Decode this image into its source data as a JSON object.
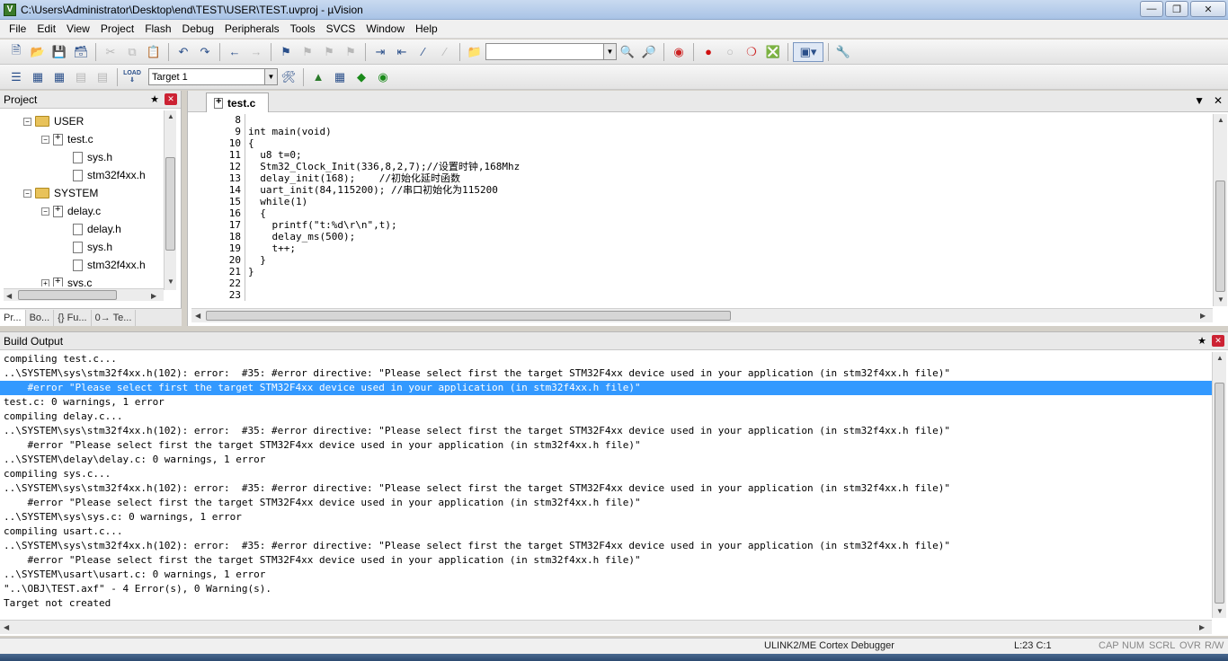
{
  "window": {
    "title": "C:\\Users\\Administrator\\Desktop\\end\\TEST\\USER\\TEST.uvproj - µVision",
    "app_icon": "V"
  },
  "menu": [
    "File",
    "Edit",
    "View",
    "Project",
    "Flash",
    "Debug",
    "Peripherals",
    "Tools",
    "SVCS",
    "Window",
    "Help"
  ],
  "toolbar2": {
    "target": "Target 1",
    "load_label": "LOAD"
  },
  "project": {
    "title": "Project",
    "tree": [
      {
        "label": "USER",
        "type": "folder",
        "level": 1
      },
      {
        "label": "test.c",
        "type": "cfile",
        "level": 2
      },
      {
        "label": "sys.h",
        "type": "hfile",
        "level": 3
      },
      {
        "label": "stm32f4xx.h",
        "type": "hfile",
        "level": 3
      },
      {
        "label": "SYSTEM",
        "type": "folder",
        "level": 1
      },
      {
        "label": "delay.c",
        "type": "cfile",
        "level": 2
      },
      {
        "label": "delay.h",
        "type": "hfile",
        "level": 3
      },
      {
        "label": "sys.h",
        "type": "hfile",
        "level": 3
      },
      {
        "label": "stm32f4xx.h",
        "type": "hfile",
        "level": 3
      },
      {
        "label": "sys.c",
        "type": "cfile",
        "level": 2
      }
    ],
    "tabs": [
      "Pr...",
      "Bo...",
      "{} Fu...",
      "0→ Te..."
    ]
  },
  "editor": {
    "tab": "test.c",
    "lines": [
      {
        "n": "8",
        "t": ""
      },
      {
        "n": "9",
        "t": "int main(void)"
      },
      {
        "n": "10",
        "t": "{"
      },
      {
        "n": "11",
        "t": "  u8 t=0;"
      },
      {
        "n": "12",
        "t": "  Stm32_Clock_Init(336,8,2,7);//设置时钟,168Mhz"
      },
      {
        "n": "13",
        "t": "  delay_init(168);    //初始化延时函数"
      },
      {
        "n": "14",
        "t": "  uart_init(84,115200); //串口初始化为115200"
      },
      {
        "n": "15",
        "t": "  while(1)"
      },
      {
        "n": "16",
        "t": "  {"
      },
      {
        "n": "17",
        "t": "    printf(\"t:%d\\r\\n\",t);"
      },
      {
        "n": "18",
        "t": "    delay_ms(500);"
      },
      {
        "n": "19",
        "t": "    t++;"
      },
      {
        "n": "20",
        "t": "  }"
      },
      {
        "n": "21",
        "t": "}"
      },
      {
        "n": "22",
        "t": ""
      },
      {
        "n": "23",
        "t": ""
      }
    ]
  },
  "build": {
    "title": "Build Output",
    "lines": [
      "compiling test.c...",
      "..\\SYSTEM\\sys\\stm32f4xx.h(102): error:  #35: #error directive: \"Please select first the target STM32F4xx device used in your application (in stm32f4xx.h file)\"",
      "    #error \"Please select first the target STM32F4xx device used in your application (in stm32f4xx.h file)\"",
      "test.c: 0 warnings, 1 error",
      "compiling delay.c...",
      "..\\SYSTEM\\sys\\stm32f4xx.h(102): error:  #35: #error directive: \"Please select first the target STM32F4xx device used in your application (in stm32f4xx.h file)\"",
      "    #error \"Please select first the target STM32F4xx device used in your application (in stm32f4xx.h file)\"",
      "..\\SYSTEM\\delay\\delay.c: 0 warnings, 1 error",
      "compiling sys.c...",
      "..\\SYSTEM\\sys\\stm32f4xx.h(102): error:  #35: #error directive: \"Please select first the target STM32F4xx device used in your application (in stm32f4xx.h file)\"",
      "    #error \"Please select first the target STM32F4xx device used in your application (in stm32f4xx.h file)\"",
      "..\\SYSTEM\\sys\\sys.c: 0 warnings, 1 error",
      "compiling usart.c...",
      "..\\SYSTEM\\sys\\stm32f4xx.h(102): error:  #35: #error directive: \"Please select first the target STM32F4xx device used in your application (in stm32f4xx.h file)\"",
      "    #error \"Please select first the target STM32F4xx device used in your application (in stm32f4xx.h file)\"",
      "..\\SYSTEM\\usart\\usart.c: 0 warnings, 1 error",
      "\"..\\OBJ\\TEST.axf\" - 4 Error(s), 0 Warning(s).",
      "Target not created"
    ],
    "selected_index": 2
  },
  "status": {
    "debugger": "ULINK2/ME Cortex Debugger",
    "position": "L:23 C:1",
    "indicators": [
      "CAP",
      "NUM",
      "SCRL",
      "OVR",
      "R/W"
    ]
  }
}
